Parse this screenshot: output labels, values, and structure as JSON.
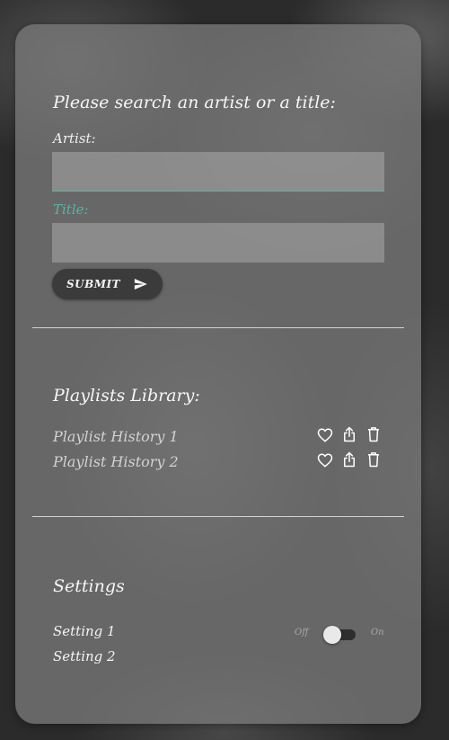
{
  "search": {
    "heading": "Please search an artist or a title:",
    "artist_label": "Artist:",
    "artist_value": "",
    "title_label": "Title:",
    "title_value": "",
    "submit_label": "SUBMIT"
  },
  "playlists": {
    "heading": "Playlists Library:",
    "items": [
      {
        "name": "Playlist History 1"
      },
      {
        "name": "Playlist History 2"
      }
    ]
  },
  "settings": {
    "heading": "Settings",
    "items": [
      {
        "label": "Setting 1",
        "off_label": "Off",
        "on_label": "On",
        "enabled": false
      },
      {
        "label": "Setting 2"
      }
    ]
  },
  "colors": {
    "accent": "#5bb3a6",
    "card": "#7a7a7a",
    "button": "#3b3b3b"
  },
  "icons": [
    "send-icon",
    "heart-icon",
    "share-icon",
    "trash-icon"
  ]
}
